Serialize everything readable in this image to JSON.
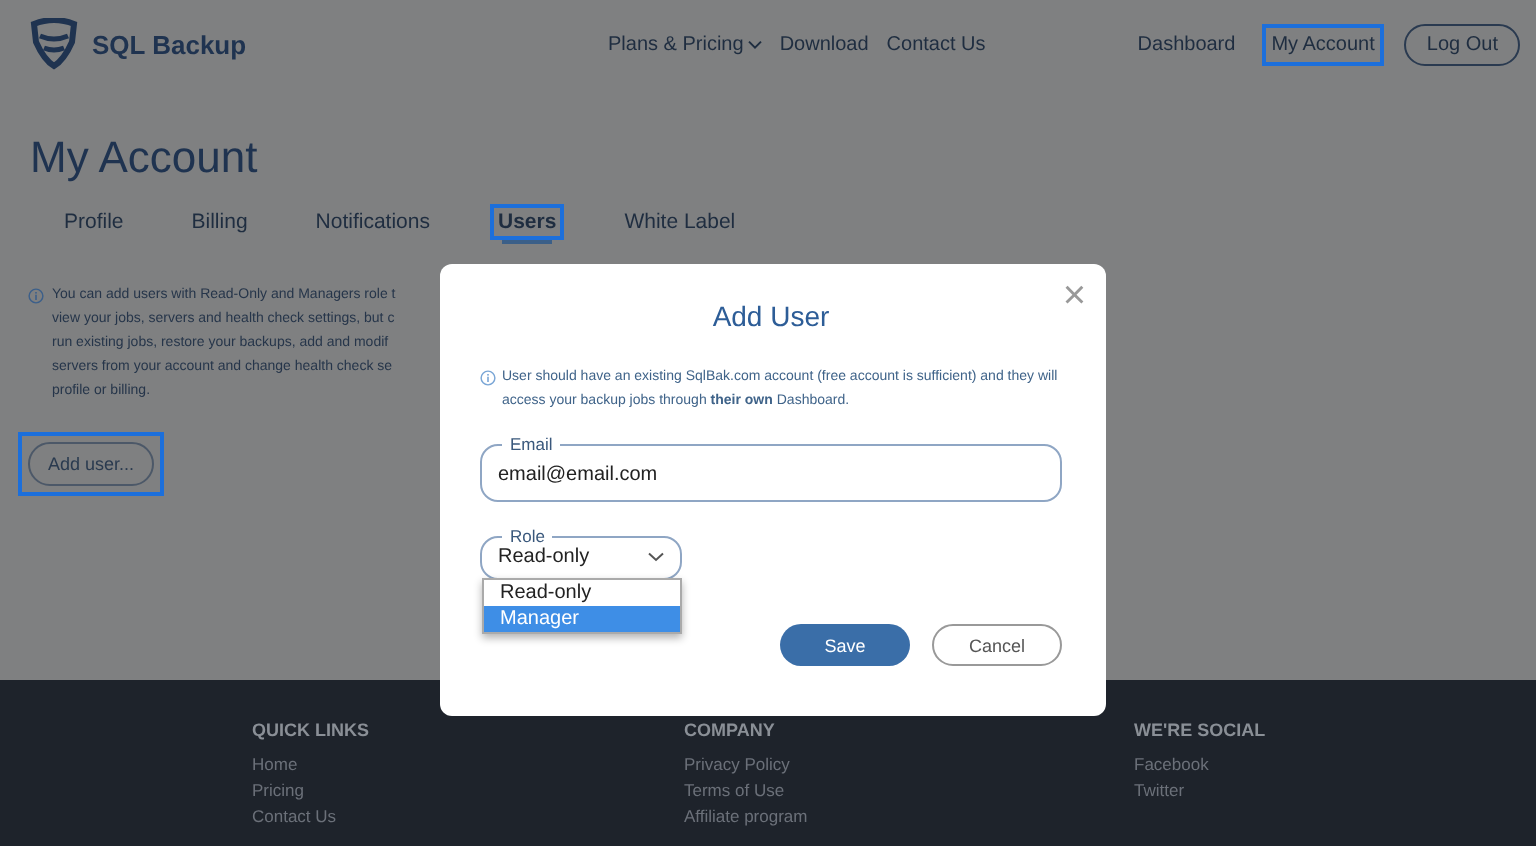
{
  "header": {
    "brand": "SQL Backup",
    "nav": [
      {
        "label": "Plans & Pricing",
        "dropdown": true
      },
      {
        "label": "Download",
        "dropdown": false
      },
      {
        "label": "Contact Us",
        "dropdown": false
      }
    ],
    "account_links": [
      {
        "label": "Dashboard",
        "highlighted": false
      },
      {
        "label": "My Account",
        "highlighted": true
      }
    ],
    "logout": "Log Out"
  },
  "page_title": "My Account",
  "tabs": [
    {
      "label": "Profile",
      "selected": false,
      "highlighted": false
    },
    {
      "label": "Billing",
      "selected": false,
      "highlighted": false
    },
    {
      "label": "Notifications",
      "selected": false,
      "highlighted": false
    },
    {
      "label": "Users",
      "selected": true,
      "highlighted": true
    },
    {
      "label": "White Label",
      "selected": false,
      "highlighted": false
    }
  ],
  "info_lines": [
    "You can add users with Read-Only and Managers role t",
    "view your jobs, servers and health check settings, but c",
    "run existing jobs, restore your backups, add and modif",
    "servers from your account and change health check se",
    "profile or billing."
  ],
  "add_user": {
    "label": "Add user...",
    "highlighted": true
  },
  "footer": [
    {
      "heading": "QUICK LINKS",
      "links": [
        "Home",
        "Pricing",
        "Contact Us"
      ]
    },
    {
      "heading": "COMPANY",
      "links": [
        "Privacy Policy",
        "Terms of Use",
        "Affiliate program"
      ]
    },
    {
      "heading": "WE'RE SOCIAL",
      "links": [
        "Facebook",
        "Twitter"
      ]
    }
  ],
  "modal": {
    "title": "Add User",
    "close": "×",
    "info": "User should have an existing SqlBak.com account (free account is sufficient) and they will access your backup jobs through **their own** Dashboard.",
    "email": {
      "label": "Email",
      "value": "email@email.com"
    },
    "role": {
      "label": "Role",
      "value": "Read-only",
      "expanded": true,
      "options": [
        {
          "label": "Read-only",
          "highlighted": false
        },
        {
          "label": "Manager",
          "highlighted": true
        }
      ]
    },
    "buttons": [
      {
        "label": "Save",
        "kind": "primary"
      },
      {
        "label": "Cancel",
        "kind": "secondary"
      }
    ]
  }
}
